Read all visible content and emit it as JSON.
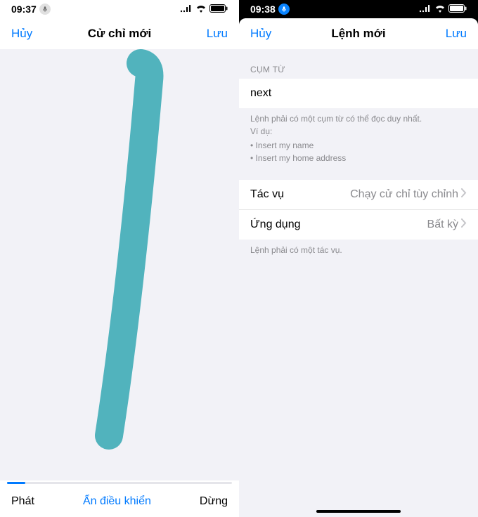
{
  "left": {
    "status": {
      "time": "09:37"
    },
    "nav": {
      "cancel": "Hủy",
      "title": "Cử chỉ mới",
      "save": "Lưu"
    },
    "progress_percent": 8,
    "toolbar": {
      "play": "Phát",
      "hide": "Ẩn điều khiển",
      "stop": "Dừng"
    }
  },
  "right": {
    "status": {
      "time": "09:38"
    },
    "nav": {
      "cancel": "Hủy",
      "title": "Lệnh mới",
      "save": "Lưu"
    },
    "section1_header": "CỤM TỪ",
    "phrase_value": "next",
    "phrase_note": {
      "line1": "Lệnh phải có một cụm từ có thể đọc duy nhất.",
      "line2": "Ví dụ:",
      "ex1": "Insert my name",
      "ex2": "Insert my home address"
    },
    "action_row": {
      "label": "Tác vụ",
      "value": "Chạy cử chỉ tùy chỉnh"
    },
    "app_row": {
      "label": "Ứng dụng",
      "value": "Bất kỳ"
    },
    "footer": "Lệnh phải có một tác vụ."
  }
}
